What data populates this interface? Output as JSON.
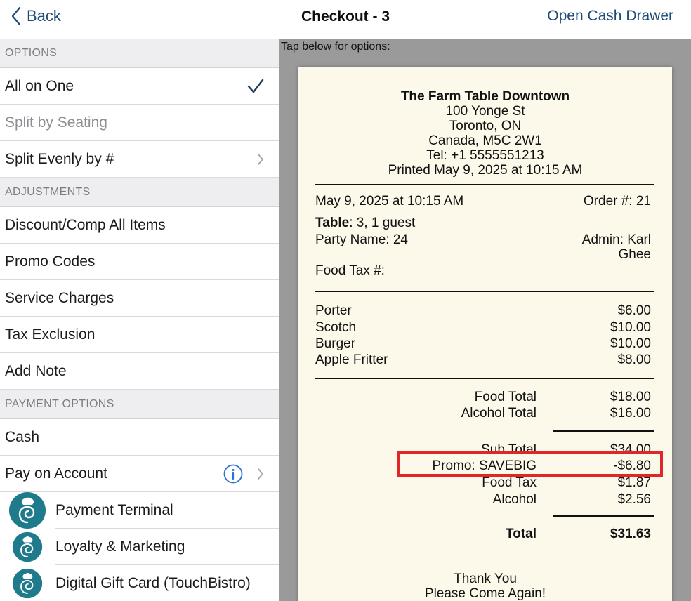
{
  "nav": {
    "back_label": "Back",
    "title": "Checkout - 3",
    "cash_drawer_label": "Open Cash Drawer"
  },
  "sidebar": {
    "options_header": "OPTIONS",
    "options": [
      {
        "label": "All on One",
        "selected": true
      },
      {
        "label": "Split by Seating",
        "disabled": true
      },
      {
        "label": "Split Evenly by #",
        "has_chevron": true
      }
    ],
    "adjustments_header": "ADJUSTMENTS",
    "adjustments": [
      {
        "label": "Discount/Comp All Items"
      },
      {
        "label": "Promo Codes"
      },
      {
        "label": "Service Charges"
      },
      {
        "label": "Tax Exclusion"
      },
      {
        "label": "Add Note"
      }
    ],
    "payment_header": "PAYMENT OPTIONS",
    "payments": [
      {
        "label": "Cash"
      },
      {
        "label": "Pay on Account",
        "icons": [
          "info-icon",
          "chevron-right-icon"
        ]
      }
    ],
    "integrations": [
      {
        "label": "Payment Terminal",
        "icon": "touchbistro-chef-icon"
      },
      {
        "label": "Loyalty & Marketing",
        "icon": "touchbistro-chef-icon"
      },
      {
        "label": "Digital Gift Card (TouchBistro)",
        "icon": "touchbistro-chef-icon"
      }
    ]
  },
  "receipt_panel": {
    "instruction": "Tap below for options:"
  },
  "receipt": {
    "restaurant": "The Farm Table Downtown",
    "address1": "100 Yonge St",
    "address2": "Toronto, ON",
    "address3": "Canada, M5C 2W1",
    "phone": "Tel: +1 5555551213",
    "printed": "Printed May 9, 2025 at 10:15 AM",
    "datetime": "May 9, 2025 at 10:15 AM",
    "order_no": "Order #: 21",
    "table_label": "Table",
    "table_value": ": 3, 1 guest",
    "party_name": "Party Name: 24",
    "admin_line1": "Admin: Karl",
    "admin_line2": "Ghee",
    "food_tax_no": "Food Tax #:",
    "items": [
      {
        "name": "Porter",
        "price": "$6.00"
      },
      {
        "name": "Scotch",
        "price": "$10.00"
      },
      {
        "name": "Burger",
        "price": "$10.00"
      },
      {
        "name": "Apple Fritter",
        "price": "$8.00"
      }
    ],
    "food_total_label": "Food Total",
    "food_total": "$18.00",
    "alcohol_total_label": "Alcohol Total",
    "alcohol_total": "$16.00",
    "subtotal_label": "Sub Total",
    "subtotal": "$34.00",
    "promo_label": "Promo: SAVEBIG",
    "promo_value": "-$6.80",
    "food_tax_label": "Food Tax",
    "food_tax": "$1.87",
    "alcohol_label": "Alcohol",
    "alcohol_tax": "$2.56",
    "total_label": "Total",
    "total": "$31.63",
    "thanks1": "Thank You",
    "thanks2": "Please Come Again!"
  },
  "colors": {
    "accent": "#1f4a78",
    "info_icon": "#2f6fd6",
    "highlight": "#e02727",
    "receipt_bg": "#fcf9ea",
    "panel_bg": "#9a9a9a",
    "brand_teal": "#1f7a8c"
  }
}
